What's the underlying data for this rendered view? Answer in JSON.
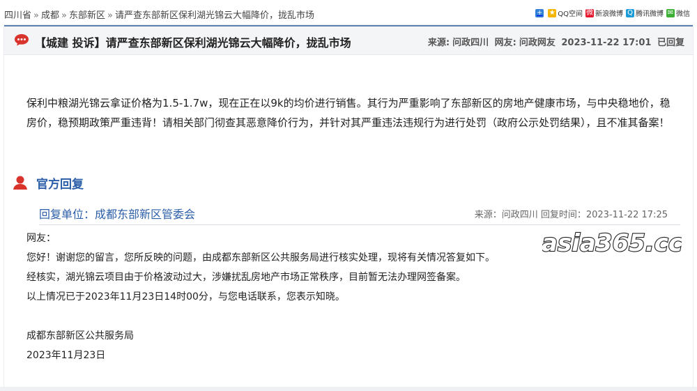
{
  "breadcrumb": {
    "items": [
      "四川省",
      "成都",
      "东部新区",
      "请严查东部新区保利湖光锦云大幅降价，拢乱市场"
    ],
    "separator": "»"
  },
  "share": {
    "items": [
      {
        "label": "",
        "icon": "plus-icon",
        "color": "#2f7fd6"
      },
      {
        "label": "QQ空间",
        "icon": "qzone-icon",
        "color": "#f5b400"
      },
      {
        "label": "新浪微博",
        "icon": "weibo-icon",
        "color": "#e6162d"
      },
      {
        "label": "腾讯微博",
        "icon": "tencent-weibo-icon",
        "color": "#1b9bd7"
      },
      {
        "label": "微信",
        "icon": "wechat-icon",
        "color": "#3cb034"
      }
    ]
  },
  "post": {
    "title": "【城建 投诉】请严查东部新区保利湖光锦云大幅降价，拢乱市场",
    "source_label": "来源:",
    "source": "问政四川",
    "user_label": "网友:",
    "user": "问政网友",
    "datetime": "2023-11-22 17:01",
    "status": "已回复",
    "content": "保利中粮湖光锦云拿证价格为1.5-1.7w，现在正在以9k的均价进行销售。其行为严重影响了东部新区的房地产健康市场，与中央稳地价，稳房价，稳预期政策严重违背！请相关部门彻查其恶意降价行为，并针对其严重违法违规行为进行处罚（政府公示处罚结果），且不准其备案！"
  },
  "reply": {
    "heading": "官方回复",
    "unit": "回复单位：成都东部新区管委会",
    "source_info": "来源：问政四川 回复时间：2023-11-22 17:25",
    "lines": [
      "网友：",
      "您好！谢谢您的留言，您所反映的问题，由成都东部新区公共服务局进行核实处理，现将有关情况答复如下。",
      "经核实，湖光锦云项目由于价格波动过大，涉嫌扰乱房地产市场正常秩序，目前暂无法办理网签备案。",
      "以上情况已于2023年11月23日14时00分，与您电话联系，您表示知晓。"
    ],
    "signature": "成都东部新区公共服务局",
    "date": "2023年11月23日"
  },
  "watermark": {
    "text": "asia365.cc"
  },
  "colors": {
    "accent": "#2a5ea8",
    "panel_border": "#5b7fb1",
    "bubble_icon": "#d9342b",
    "person_icon": "#d9342b"
  }
}
